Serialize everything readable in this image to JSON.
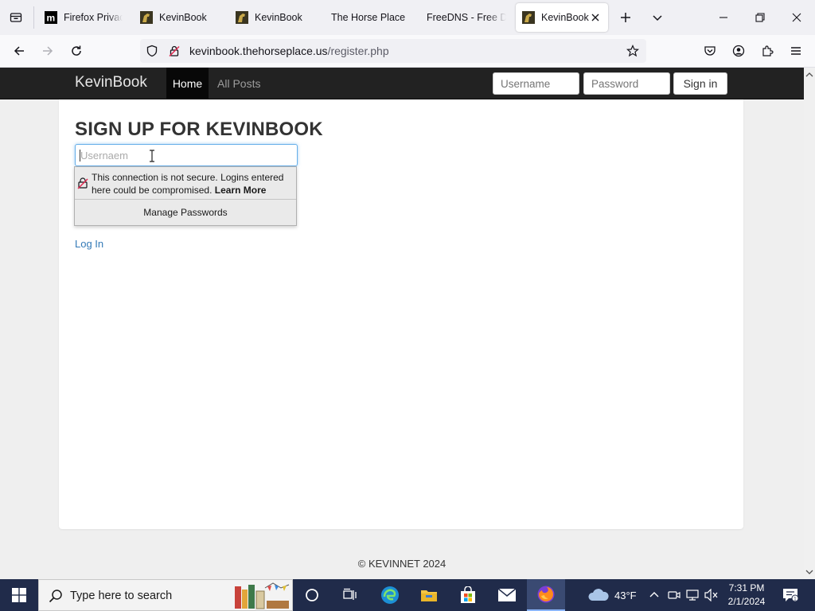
{
  "browser": {
    "tabs": [
      {
        "title": "Firefox Privacy",
        "favicon": "mozilla-m-icon"
      },
      {
        "title": "KevinBook",
        "favicon": "horse-favicon"
      },
      {
        "title": "KevinBook",
        "favicon": "horse-favicon"
      },
      {
        "title": "The Horse Place",
        "favicon": ""
      },
      {
        "title": "FreeDNS - Free DNS",
        "favicon": ""
      },
      {
        "title": "KevinBook",
        "favicon": "horse-favicon",
        "active": true
      }
    ],
    "url": {
      "host": "kevinbook.thehorseplace.us",
      "path": "/register.php"
    }
  },
  "site": {
    "brand": "KevinBook",
    "nav": {
      "home": "Home",
      "all_posts": "All Posts"
    },
    "login": {
      "username_placeholder": "Username",
      "password_placeholder": "Password",
      "signin_label": "Sign in"
    }
  },
  "page": {
    "title": "SIGN UP FOR KEVINBOOK",
    "username_placeholder": "Usernaem",
    "autofill": {
      "warning": "This connection is not secure. Logins entered here could be compromised.",
      "learn_more": "Learn More",
      "manage": "Manage Passwords"
    },
    "login_link": "Log In",
    "footer": "© KEVINNET 2024"
  },
  "taskbar": {
    "search_placeholder": "Type here to search",
    "weather": "43°F",
    "time": "7:31 PM",
    "date": "2/1/2024"
  },
  "colors": {
    "site_navbar": "#222222",
    "link": "#337ab7",
    "taskbar": "#202b4a",
    "focus_ring": "#66afe9"
  }
}
